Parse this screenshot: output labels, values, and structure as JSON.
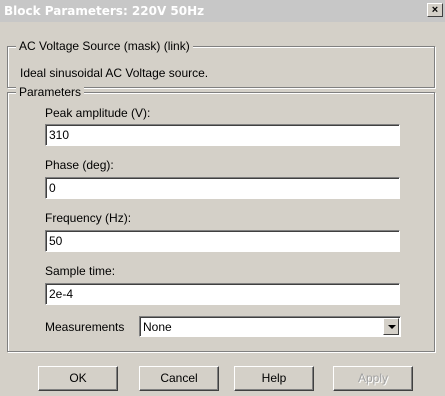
{
  "window": {
    "title": "Block Parameters: 220V 50Hz",
    "close_symbol": "×"
  },
  "mask_group": {
    "legend": "AC Voltage Source (mask) (link)",
    "description": "Ideal sinusoidal AC Voltage source."
  },
  "params_group": {
    "legend": "Parameters",
    "fields": [
      {
        "label": "Peak amplitude (V):",
        "value": "310"
      },
      {
        "label": "Phase (deg):",
        "value": "0"
      },
      {
        "label": "Frequency (Hz):",
        "value": "50"
      },
      {
        "label": "Sample time:",
        "value": "2e-4"
      }
    ],
    "measurements": {
      "label": "Measurements",
      "selected": "None"
    }
  },
  "buttons": {
    "ok": "OK",
    "cancel": "Cancel",
    "help": "Help",
    "apply": "Apply"
  },
  "colors": {
    "background": "#d4d0c8",
    "titlebar": "#c7c7c7",
    "disabled_text": "#a0a0a0"
  },
  "icons": {
    "close": "close-icon",
    "dropdown": "chevron-down-icon"
  }
}
